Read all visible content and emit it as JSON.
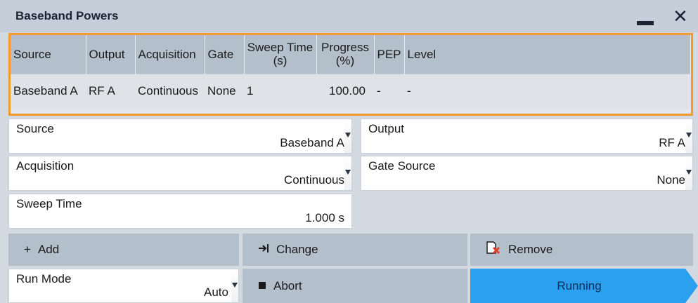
{
  "dialog": {
    "title": "Baseband Powers"
  },
  "table": {
    "headers": [
      "Source",
      "Output",
      "Acquisition",
      "Gate",
      "Sweep Time\n(s)",
      "Progress\n(%)",
      "PEP",
      "Level"
    ],
    "rows": [
      [
        "Baseband A",
        "RF A",
        "Continuous",
        "None",
        "1",
        "100.00",
        "-",
        "-"
      ]
    ]
  },
  "fields": {
    "source": {
      "label": "Source",
      "value": "Baseband A"
    },
    "output": {
      "label": "Output",
      "value": "RF A"
    },
    "acquisition": {
      "label": "Acquisition",
      "value": "Continuous"
    },
    "gate_source": {
      "label": "Gate Source",
      "value": "None"
    },
    "sweep_time": {
      "label": "Sweep Time",
      "value": "1.000 s"
    },
    "run_mode": {
      "label": "Run Mode",
      "value": "Auto"
    }
  },
  "buttons": {
    "add": "Add",
    "change": "Change",
    "remove": "Remove",
    "abort": "Abort",
    "running": "Running"
  },
  "icons": {
    "minimize": "minimize-icon",
    "close": "close-icon",
    "add": "plus-icon",
    "change": "arrow-to-bar-icon",
    "remove": "remove-document-icon",
    "abort": "stop-square-icon",
    "dropdown": "dropdown-arrow-icon"
  },
  "colors": {
    "accent_border": "#f29a2e",
    "running": "#2aa0ee",
    "button": "#b4bfcc"
  }
}
